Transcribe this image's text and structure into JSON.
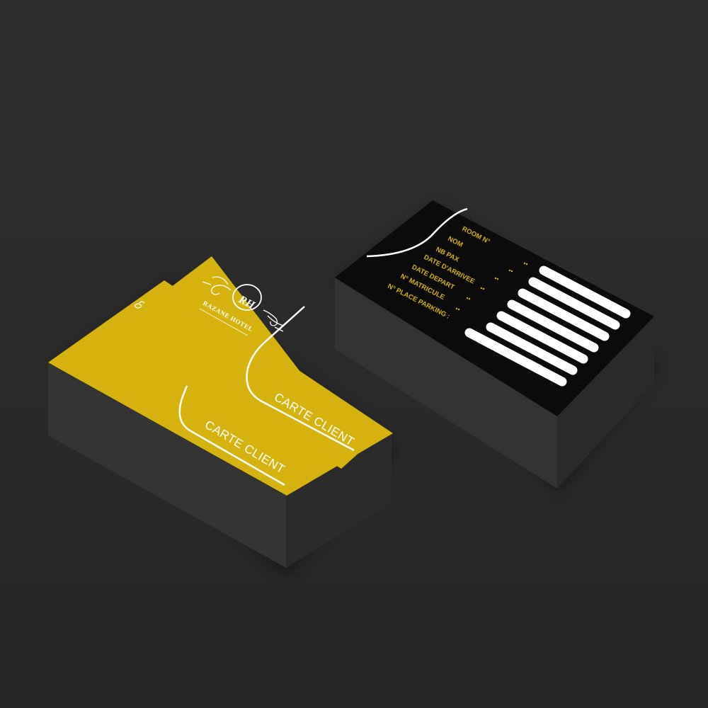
{
  "colors": {
    "background": "#2b2b2b",
    "gold": "#d6b20f",
    "card_black": "#0b0b0b",
    "stack_dark": "#353535",
    "white": "#ffffff"
  },
  "front_card": {
    "logo_monogram": "RH",
    "logo_name": "RAZANE HOTEL",
    "title": "CARTE CLIENT"
  },
  "back_card": {
    "fields": [
      "ROOM N°",
      "NOM",
      "NB PAX",
      "DATE D'ARRIVEE",
      "DATE DEPART",
      "N° MATRICULE",
      "N° PLACE PARKING :"
    ]
  }
}
